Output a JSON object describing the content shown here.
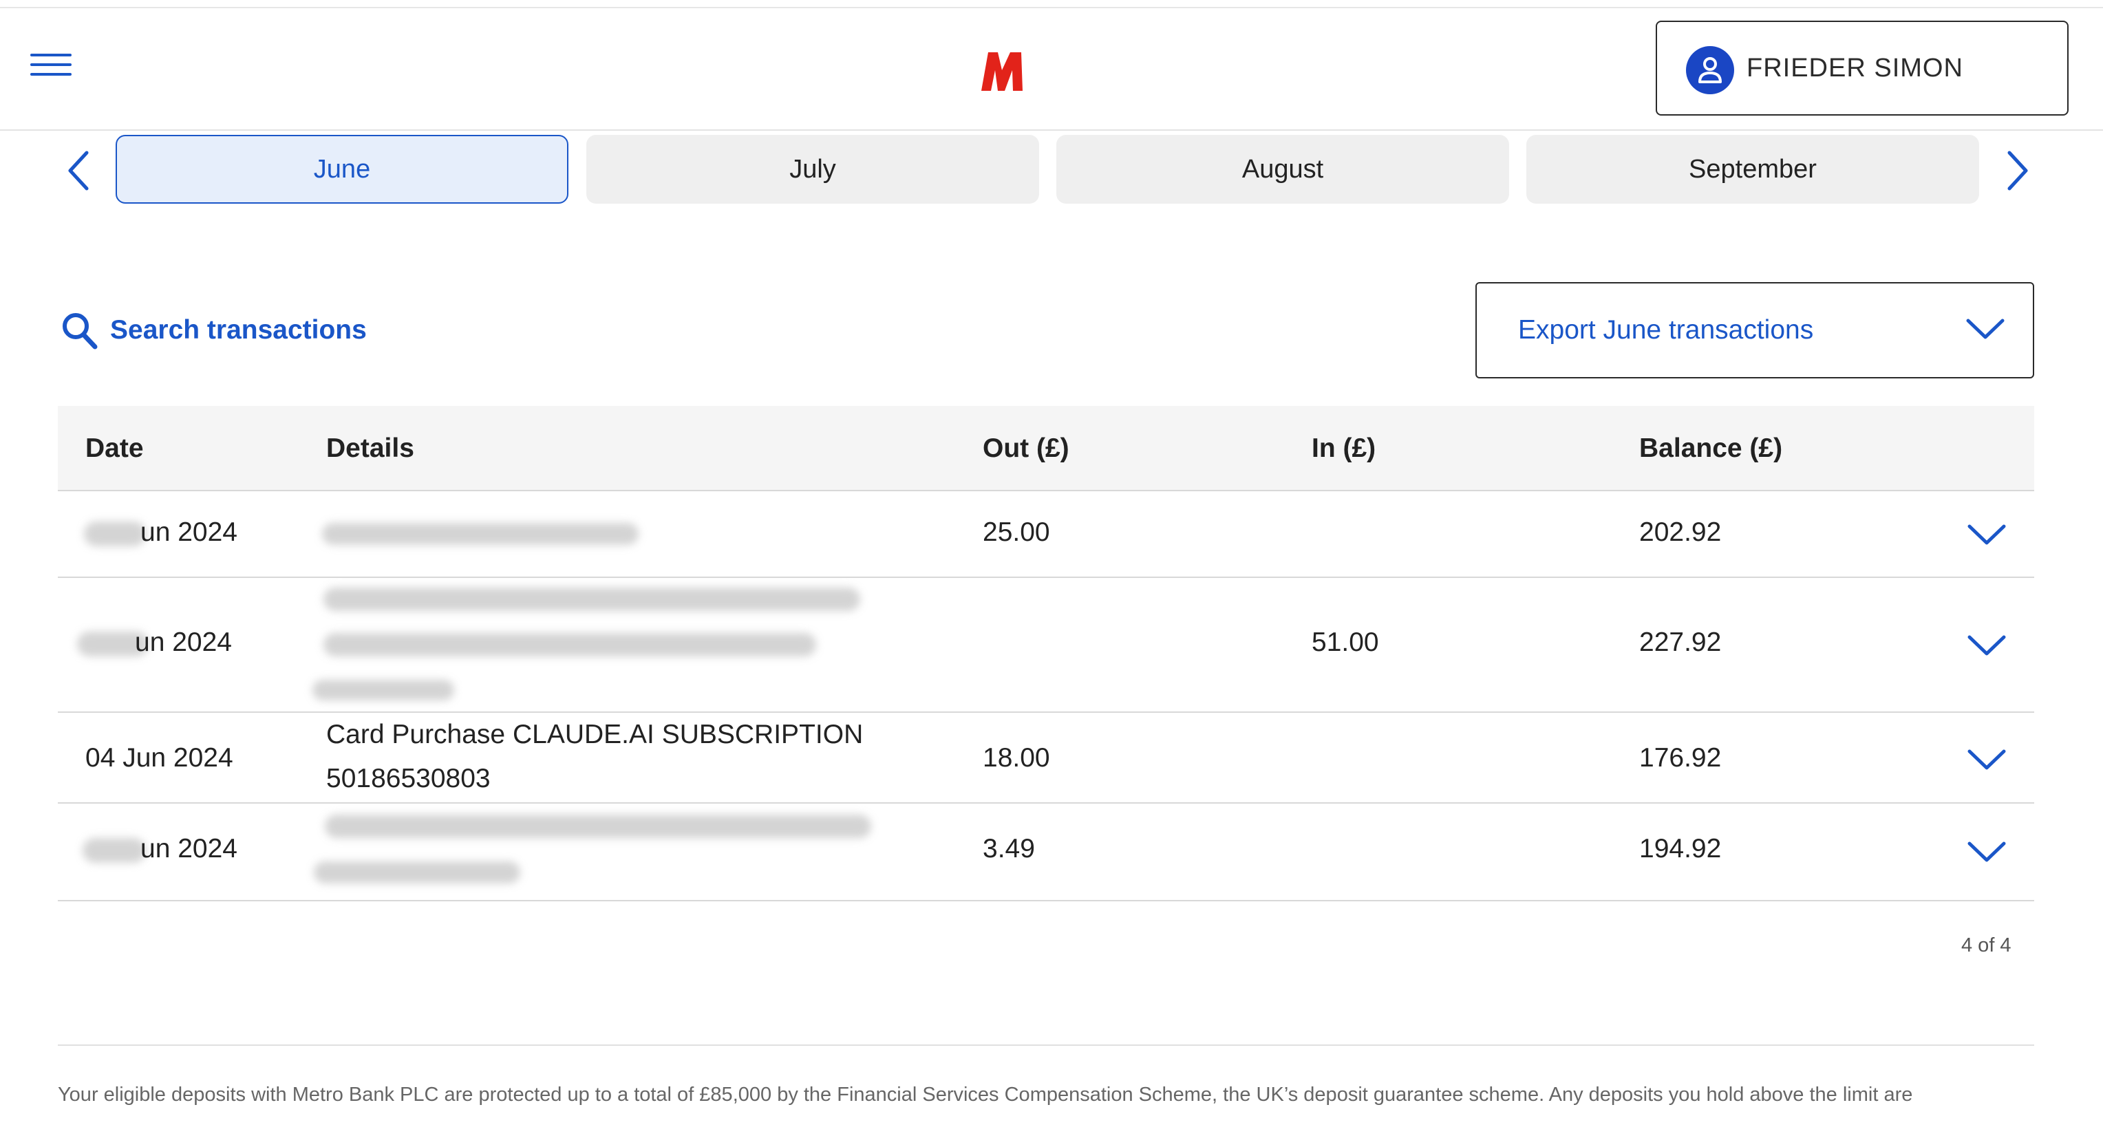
{
  "header": {
    "menu_icon": "hamburger-icon",
    "logo_icon": "metro-bank-m-logo",
    "user_name": "FRIEDER SIMON",
    "user_icon": "person-icon"
  },
  "months": {
    "prev_icon": "chevron-left-icon",
    "next_icon": "chevron-right-icon",
    "tabs": [
      {
        "label": "June",
        "active": true
      },
      {
        "label": "July",
        "active": false
      },
      {
        "label": "August",
        "active": false
      },
      {
        "label": "September",
        "active": false
      }
    ]
  },
  "search": {
    "label": "Search transactions",
    "icon": "search-icon"
  },
  "export": {
    "label": "Export June transactions",
    "icon": "chevron-down-icon"
  },
  "table": {
    "headers": {
      "date": "Date",
      "details": "Details",
      "out": "Out (£)",
      "in": "In (£)",
      "balance": "Balance (£)"
    },
    "rows": [
      {
        "date": "un 2024",
        "details": "",
        "out": "25.00",
        "in": "",
        "balance": "202.92"
      },
      {
        "date": "un 2024",
        "details": "",
        "out": "",
        "in": "51.00",
        "balance": "227.92"
      },
      {
        "date": "04 Jun 2024",
        "details": "Card Purchase CLAUDE.AI SUBSCRIPTION 50186530803",
        "out": "18.00",
        "in": "",
        "balance": "176.92"
      },
      {
        "date": "un 2024",
        "details": "",
        "out": "3.49",
        "in": "",
        "balance": "194.92"
      }
    ]
  },
  "pager": "4 of 4",
  "footnote": "Your eligible deposits with Metro Bank PLC are protected up to a total of £85,000 by the Financial Services Compensation Scheme, the UK’s deposit guarantee scheme. Any deposits you hold above the limit are",
  "colors": {
    "accent": "#1a56c8",
    "logo": "#e2231a",
    "avatar": "#1a46c4"
  }
}
